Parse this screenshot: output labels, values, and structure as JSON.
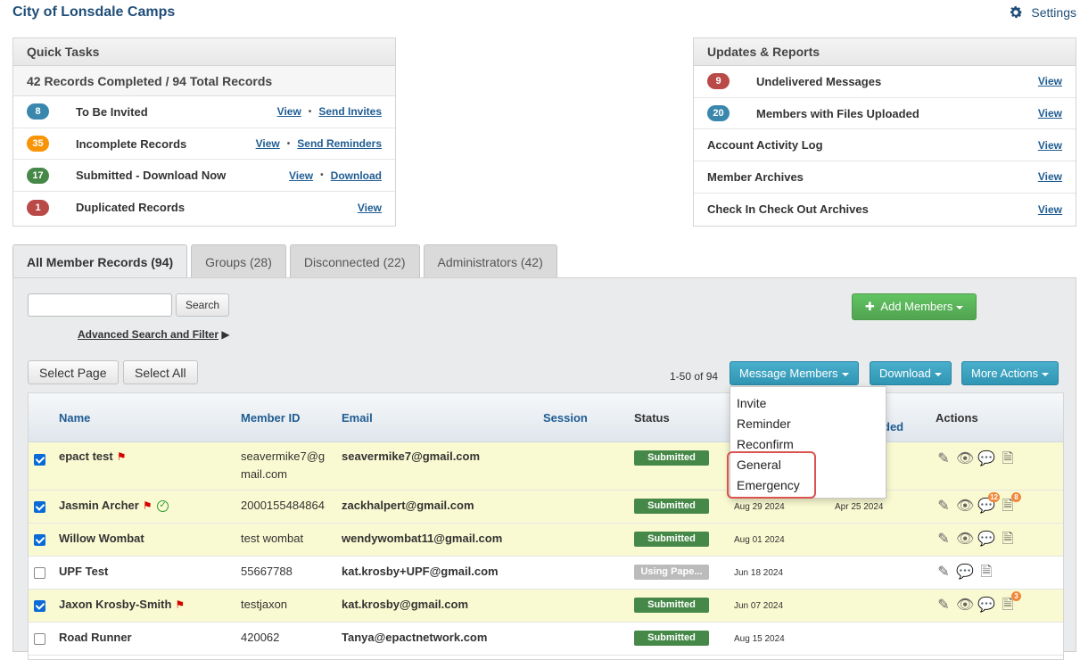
{
  "header": {
    "title": "City of Lonsdale Camps",
    "settings_label": "Settings"
  },
  "quick_tasks": {
    "title": "Quick Tasks",
    "summary": "42 Records Completed / 94 Total Records",
    "rows": [
      {
        "count": "8",
        "color": "#3a87ad",
        "label": "To Be Invited",
        "link1": "View",
        "link2": "Send Invites"
      },
      {
        "count": "35",
        "color": "#f89406",
        "label": "Incomplete Records",
        "link1": "View",
        "link2": "Send Reminders"
      },
      {
        "count": "17",
        "color": "#468847",
        "label": "Submitted - Download Now",
        "link1": "View",
        "link2": "Download"
      },
      {
        "count": "1",
        "color": "#b94a48",
        "label": "Duplicated Records",
        "link1": "View"
      }
    ]
  },
  "updates": {
    "title": "Updates & Reports",
    "rows": [
      {
        "count": "9",
        "label": "Undelivered Messages",
        "link": "View"
      },
      {
        "count": "20",
        "label": "Members with Files Uploaded",
        "link": "View"
      },
      {
        "label": "Account Activity Log",
        "link": "View"
      },
      {
        "label": "Member Archives",
        "link": "View"
      },
      {
        "label": "Check In Check Out Archives",
        "link": "View"
      }
    ]
  },
  "tabs": [
    "All Member Records (94)",
    "Groups (28)",
    "Disconnected (22)",
    "Administrators (42)"
  ],
  "toolbar": {
    "search_button": "Search",
    "advanced_search": "Advanced Search and Filter",
    "add_members": "Add Members",
    "select_page": "Select Page",
    "select_all": "Select All",
    "pager": "1-50 of 94",
    "message_members": "Message Members",
    "download": "Download",
    "more_actions": "More Actions"
  },
  "table": {
    "headers": {
      "name": "Name",
      "member_id": "Member ID",
      "email": "Email",
      "session": "Session",
      "status": "Status",
      "uploaded_fragment": "ded",
      "actions": "Actions"
    },
    "rows": [
      {
        "name": "epact test",
        "member_id": "seavermike7@gmail.com",
        "member_id_l1": "seavermike7@g",
        "member_id_l2": "mail.com",
        "email": "seavermike7@gmail.com",
        "status": "Submitted",
        "date1": "",
        "date2": ""
      },
      {
        "name": "Jasmin Archer",
        "member_id": "2000155484864",
        "email": "zackhalpert@gmail.com",
        "status": "Submitted",
        "date1": "Aug 29 2024",
        "date2": "Apr 25 2024",
        "msg_count": "12",
        "file_count": "8"
      },
      {
        "name": "Willow Wombat",
        "member_id": "test wombat",
        "email": "wendywombat11@gmail.com",
        "status": "Submitted",
        "date1": "Aug 01 2024",
        "date2": ""
      },
      {
        "name": "UPF Test",
        "member_id": "55667788",
        "email": "kat.krosby+UPF@gmail.com",
        "status": "Using Pape...",
        "date1": "Jun 18 2024",
        "date2": ""
      },
      {
        "name": "Jaxon Krosby-Smith",
        "member_id": "testjaxon",
        "email": "kat.krosby@gmail.com",
        "status": "Submitted",
        "date1": "Jun 07 2024",
        "date2": "",
        "file_count": "3"
      },
      {
        "name": "Road Runner",
        "member_id": "420062",
        "email": "Tanya@epactnetwork.com",
        "status": "Submitted",
        "date1": "Aug 15 2024",
        "date2": ""
      }
    ]
  },
  "message_menu": [
    "Invite",
    "Reminder",
    "Reconfirm",
    "General",
    "Emergency"
  ]
}
